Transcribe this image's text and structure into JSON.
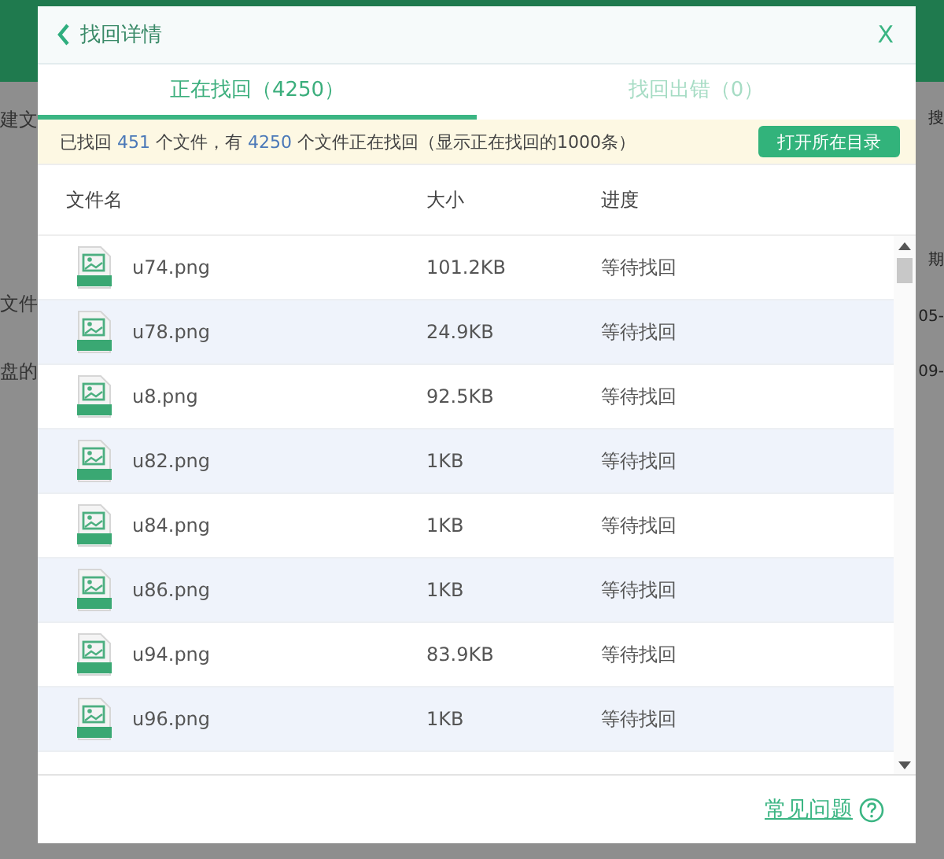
{
  "background": {
    "left_texts": [
      "建文",
      "文件",
      "盘的"
    ],
    "right_texts": [
      "搜",
      "期",
      "05-",
      "09-"
    ]
  },
  "dialog": {
    "title": "找回详情",
    "close": "X",
    "tabs": [
      {
        "label": "正在找回（4250）",
        "selected": true
      },
      {
        "label": "找回出错（0）",
        "selected": false
      }
    ],
    "info": {
      "text": "已找回 **451** 个文件，有 **4250** 个文件正在找回（显示正在找回的1000条）",
      "button": "打开所在目录"
    },
    "table": {
      "columns": [
        "文件名",
        "大小",
        "进度"
      ],
      "rows": [
        {
          "name": "u74.png",
          "size": "101.2KB",
          "progress": "等待找回"
        },
        {
          "name": "u78.png",
          "size": "24.9KB",
          "progress": "等待找回"
        },
        {
          "name": "u8.png",
          "size": "92.5KB",
          "progress": "等待找回"
        },
        {
          "name": "u82.png",
          "size": "1KB",
          "progress": "等待找回"
        },
        {
          "name": "u84.png",
          "size": "1KB",
          "progress": "等待找回"
        },
        {
          "name": "u86.png",
          "size": "1KB",
          "progress": "等待找回"
        },
        {
          "name": "u94.png",
          "size": "83.9KB",
          "progress": "等待找回"
        },
        {
          "name": "u96.png",
          "size": "1KB",
          "progress": "等待找回"
        }
      ]
    },
    "footer": {
      "link": "常见问题"
    }
  }
}
